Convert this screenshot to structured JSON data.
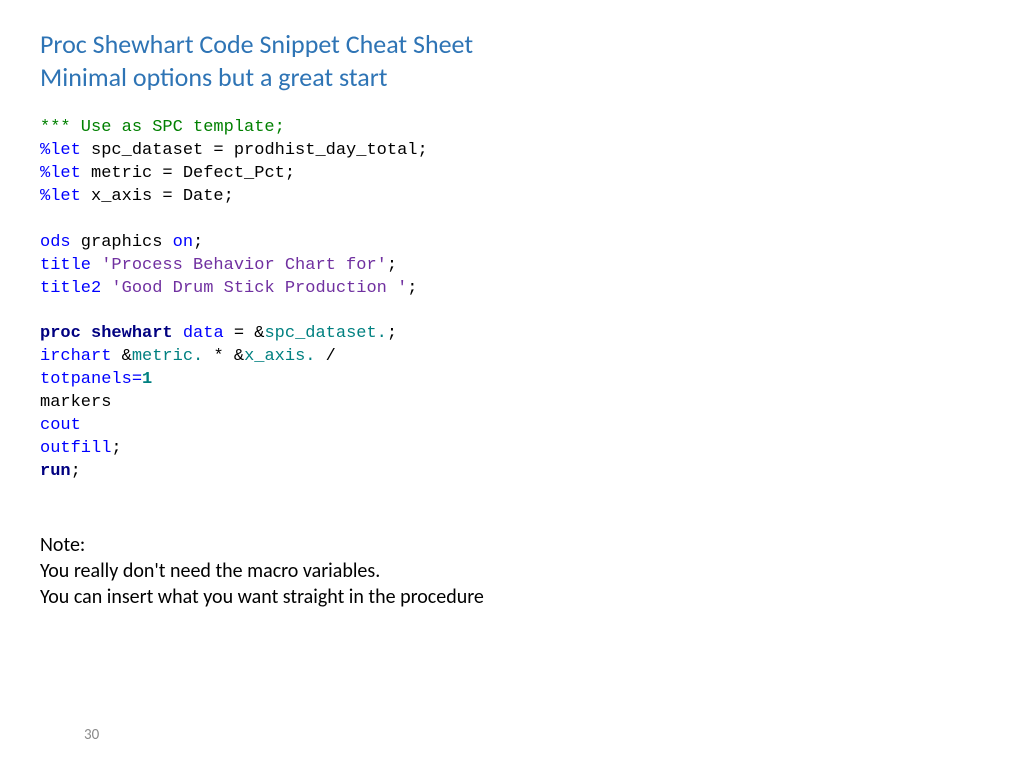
{
  "title": "Proc Shewhart Code Snippet Cheat Sheet",
  "subtitle": "Minimal options but a great start",
  "code": {
    "l1_comment": "*** Use as SPC template;",
    "l2_keyword": "%let",
    "l2_rest": " spc_dataset = prodhist_day_total;",
    "l3_keyword": "%let",
    "l3_rest": " metric = Defect_Pct;",
    "l4_keyword": "%let",
    "l4_rest": " x_axis = Date;",
    "l5_a": "ods",
    "l5_b": " graphics ",
    "l5_c": "on",
    "l5_d": ";",
    "l6_a": "title",
    "l6_b": " 'Process Behavior Chart for'",
    "l6_c": ";",
    "l7_a": "title2",
    "l7_b": " 'Good Drum Stick Production '",
    "l7_c": ";",
    "l8_proc": "proc",
    "l8_shewhart": " shewhart",
    "l8_data": " data",
    "l8_eq": " = &",
    "l8_ds": "spc_dataset.",
    "l8_semi": ";",
    "l9_a": "irchart",
    "l9_amp1": " &",
    "l9_metric": "metric.",
    "l9_star": " * &",
    "l9_xaxis": "x_axis.",
    "l9_slash": " /",
    "l10_a": "totpanels=",
    "l10_b": "1",
    "l11": "markers",
    "l12": "cout",
    "l13_a": "outfill",
    "l13_b": ";",
    "l14_a": "run",
    "l14_b": ";"
  },
  "note": {
    "l1": "Note:",
    "l2": "You really don't need the macro variables.",
    "l3": "You can insert what you want straight in the procedure"
  },
  "page_number": "30"
}
